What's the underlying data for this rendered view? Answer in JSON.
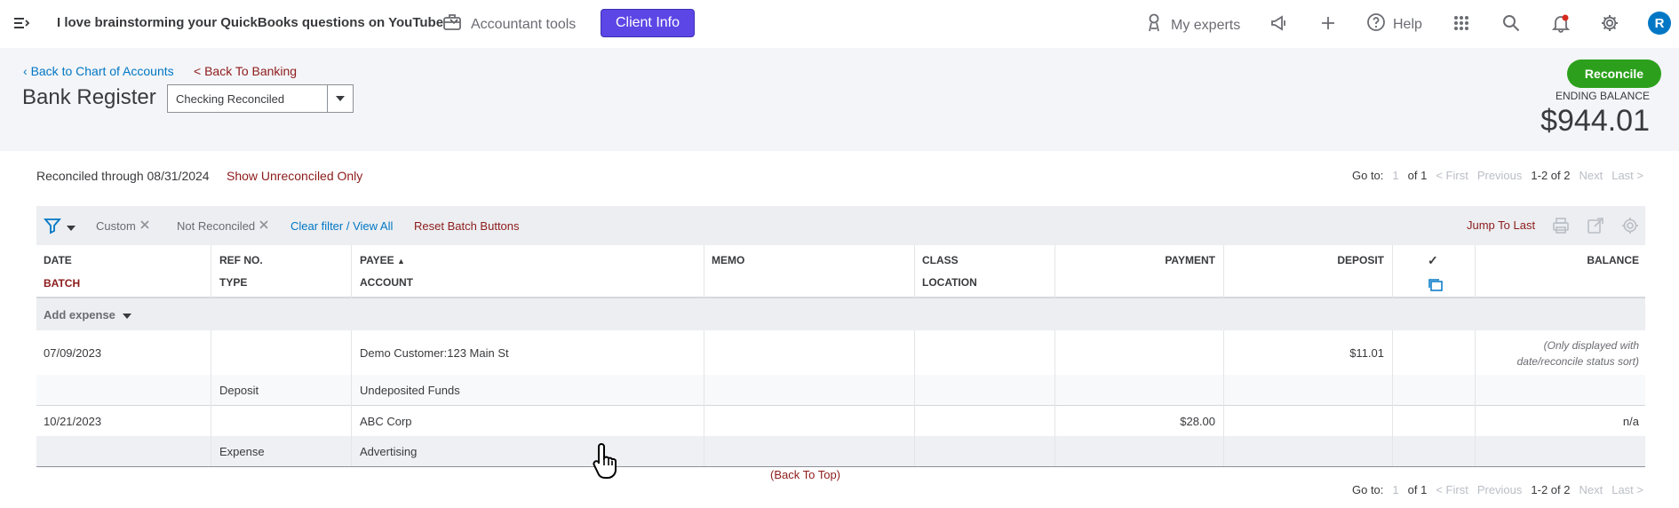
{
  "topbar": {
    "company": "I love brainstorming your QuickBooks questions on YouTube",
    "accountant_tools": "Accountant tools",
    "client_info": "Client Info",
    "my_experts": "My experts",
    "help": "Help",
    "avatar_initial": "R"
  },
  "header": {
    "back_coa": "Back to Chart of Accounts",
    "back_banking": "< Back To Banking",
    "title": "Bank Register",
    "account_value": "Checking Reconciled",
    "reconcile": "Reconcile",
    "ending_label": "ENDING BALANCE",
    "ending_amount": "$944.01"
  },
  "info": {
    "reconciled_through": "Reconciled through 08/31/2024",
    "show_unreconciled": "Show Unreconciled Only"
  },
  "pager": {
    "goto": "Go to:",
    "page": "1",
    "of": "of 1",
    "first": "< First",
    "previous": "Previous",
    "range": "1-2 of 2",
    "next": "Next",
    "last": "Last >"
  },
  "filterbar": {
    "chip_custom": "Custom",
    "chip_not_reconciled": "Not Reconciled",
    "clear_filter": "Clear filter / View All",
    "reset_batch": "Reset Batch Buttons",
    "jump_last": "Jump To Last"
  },
  "columns": {
    "date": "DATE",
    "batch": "BATCH",
    "ref_no": "REF NO.",
    "type": "TYPE",
    "payee": "PAYEE",
    "account": "ACCOUNT",
    "memo": "MEMO",
    "class": "CLASS",
    "location": "LOCATION",
    "payment": "PAYMENT",
    "deposit": "DEPOSIT",
    "check": "✓",
    "balance": "BALANCE"
  },
  "add_expense": "Add expense",
  "rows": [
    {
      "date": "07/09/2023",
      "type": "Deposit",
      "payee": "Demo Customer:123 Main St",
      "account": "Undeposited Funds",
      "payment": "",
      "deposit": "$11.01",
      "balance": "(Only displayed with date/reconcile status sort)"
    },
    {
      "date": "10/21/2023",
      "type": "Expense",
      "payee": "ABC Corp",
      "account": "Advertising",
      "payment": "$28.00",
      "deposit": "",
      "balance": "n/a"
    }
  ],
  "back_to_top": "(Back To Top)",
  "colors": {
    "accent_purple": "#5c46e6",
    "reconcile_green": "#2ca01c",
    "link_blue": "#0077c5",
    "link_red": "#8d1b1b"
  }
}
